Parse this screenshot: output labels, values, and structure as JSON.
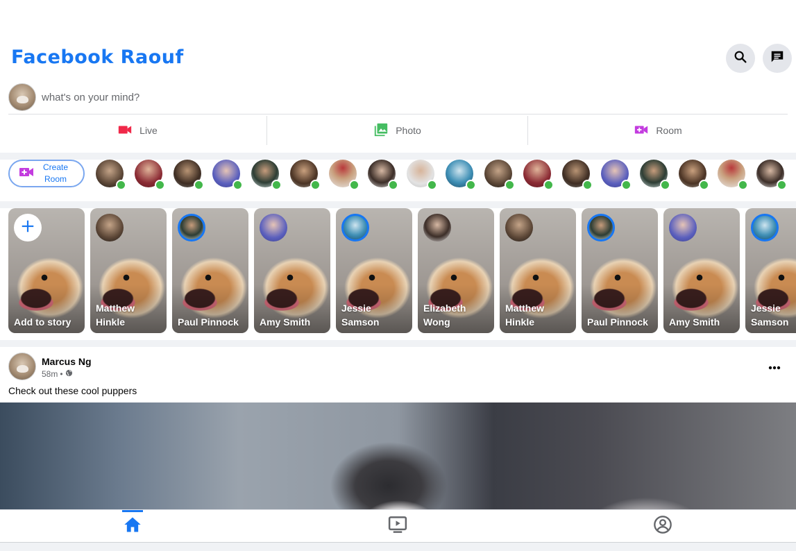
{
  "app": {
    "title": "Facebook Raouf",
    "brand_color": "#1877f2",
    "header_icons": [
      "search-icon",
      "messenger-icon"
    ]
  },
  "composer": {
    "placeholder": "what's on your mind?",
    "actions": [
      {
        "label": "Live",
        "icon": "videocam-icon",
        "color": "#f02849"
      },
      {
        "label": "Photo",
        "icon": "photo-library-icon",
        "color": "#45bd62"
      },
      {
        "label": "Room",
        "icon": "video-call-icon",
        "color": "#c33cdf"
      }
    ]
  },
  "rooms": {
    "create_label": "Create Room",
    "online_color": "#43b74b",
    "contacts_count_visible": 18
  },
  "stories": {
    "add_label": "Add to story",
    "items": [
      {
        "name": "Matthew Hinkle",
        "viewed": true
      },
      {
        "name": "Paul Pinnock",
        "viewed": false
      },
      {
        "name": "Amy Smith",
        "viewed": true
      },
      {
        "name": "Jessie Samson",
        "viewed": false
      },
      {
        "name": "Elizabeth Wong",
        "viewed": true
      },
      {
        "name": "Matthew Hinkle",
        "viewed": true
      },
      {
        "name": "Paul Pinnock",
        "viewed": false
      },
      {
        "name": "Amy Smith",
        "viewed": true
      },
      {
        "name": "Jessie Samson",
        "viewed": false
      }
    ]
  },
  "post": {
    "author": "Marcus Ng",
    "time": "58m",
    "separator": "•",
    "privacy_icon": "public-icon",
    "text": "Check out these cool puppers"
  },
  "bottom_nav": {
    "items": [
      {
        "icon": "home-icon",
        "active": true
      },
      {
        "icon": "ondemand-video-icon",
        "active": false
      },
      {
        "icon": "account-circle-icon",
        "active": false
      }
    ]
  }
}
